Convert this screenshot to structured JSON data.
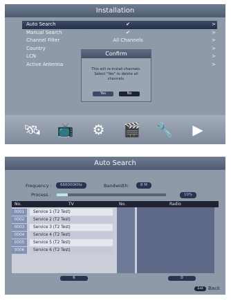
{
  "installation": {
    "title": "Installation",
    "menu": [
      {
        "label": "Auto Search",
        "value": "✔",
        "arrow": ">"
      },
      {
        "label": "Manual Search",
        "value": "✔",
        "arrow": ">"
      },
      {
        "label": "Channel Filter",
        "value": "All Channels",
        "arrow": ">"
      },
      {
        "label": "Country",
        "value": "",
        "arrow": ">"
      },
      {
        "label": "LCN",
        "value": "",
        "arrow": ">"
      },
      {
        "label": "Active Antenna",
        "value": "",
        "arrow": ">"
      }
    ],
    "dialog": {
      "title": "Confirm",
      "message": "This will re-install channels.\nSelect \"Yes\" to delete all\nchannels.",
      "yes": "Yes",
      "no": "No"
    },
    "icons": [
      "satellite-icon",
      "tv-icon",
      "gear-icon",
      "channel-icon",
      "tools-icon",
      "media-icon"
    ]
  },
  "auto_search": {
    "title": "Auto Search",
    "frequency_label": "Frequency :",
    "frequency_value": "666000KHz",
    "bandwidth_label": "Bandwidth:",
    "bandwidth_value": "8 M",
    "process_label": "Process :",
    "process_percent": "10%",
    "progress_fraction": 0.1,
    "headers": {
      "no": "No.",
      "tv": "TV",
      "no2": "No.",
      "radio": "Radio"
    },
    "rows": [
      {
        "no": "0001",
        "name": "Service 1 (T2 Test)"
      },
      {
        "no": "0002",
        "name": "Service 2 (T2 Test)"
      },
      {
        "no": "0003",
        "name": "Service 3 (T2 Test)"
      },
      {
        "no": "0004",
        "name": "Service 4 (T2 Test)"
      },
      {
        "no": "0005",
        "name": "Service 5 (T2 Test)"
      },
      {
        "no": "0006",
        "name": "Service 6 (T2 Test)"
      }
    ],
    "tv_count": "6",
    "radio_count": "0",
    "exit_key": "Exit",
    "exit_label": "Back"
  }
}
